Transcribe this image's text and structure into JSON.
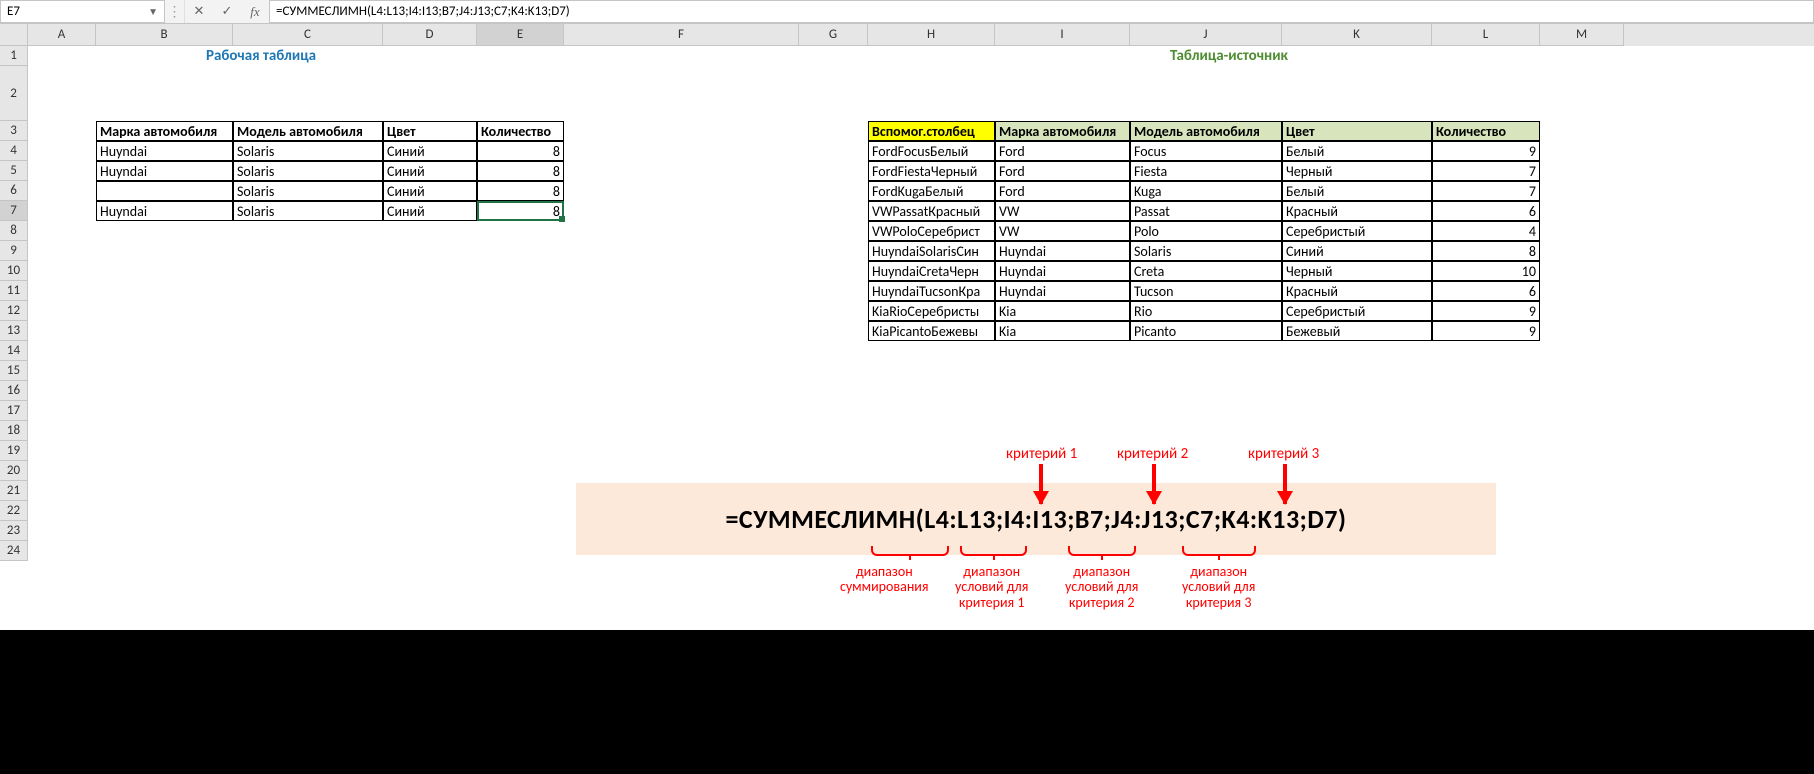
{
  "nameBox": "E7",
  "formula": "=СУММЕСЛИМН(L4:L13;I4:I13;B7;J4:J13;C7;K4:K13;D7)",
  "cols": [
    "",
    "A",
    "B",
    "C",
    "D",
    "E",
    "F",
    "G",
    "H",
    "I",
    "J",
    "K",
    "L",
    "M"
  ],
  "selectedCol": "E",
  "selectedRow": 7,
  "title1": "Рабочая таблица",
  "title2": "Таблица-источник",
  "wt": {
    "headers": [
      "Марка автомобиля",
      "Модель автомобиля",
      "Цвет",
      "Количество"
    ],
    "rows": [
      [
        "Huyndai",
        "Solaris",
        "Синий",
        "8"
      ],
      [
        "Huyndai",
        "Solaris",
        "Синий",
        "8"
      ],
      [
        "",
        "Solaris",
        "Синий",
        "8"
      ],
      [
        "Huyndai",
        "Solaris",
        "Синий",
        "8"
      ]
    ]
  },
  "st": {
    "headers": [
      "Вспомог.столбец",
      "Марка автомобиля",
      "Модель автомобиля",
      "Цвет",
      "Количество"
    ],
    "rows": [
      [
        "FordFocusБелый",
        "Ford",
        "Focus",
        "Белый",
        "9"
      ],
      [
        "FordFiestaЧерный",
        "Ford",
        "Fiesta",
        "Черный",
        "7"
      ],
      [
        "FordKugaБелый",
        "Ford",
        "Kuga",
        "Белый",
        "7"
      ],
      [
        "VWPassatКрасный",
        "VW",
        "Passat",
        "Красный",
        "6"
      ],
      [
        "VWPoloСеребрист",
        "VW",
        "Polo",
        "Серебристый",
        "4"
      ],
      [
        "HuyndaiSolarisСин",
        "Huyndai",
        "Solaris",
        "Синий",
        "8"
      ],
      [
        "HuyndaiCretaЧерн",
        "Huyndai",
        "Creta",
        "Черный",
        "10"
      ],
      [
        "HuyndaiTucsonКра",
        "Huyndai",
        "Tucson",
        "Красный",
        "6"
      ],
      [
        "KiaRioСеребристы",
        "Kia",
        "Rio",
        "Серебристый",
        "9"
      ],
      [
        "KiaPicantoБежевы",
        "Kia",
        "Picanto",
        "Бежевый",
        "9"
      ]
    ]
  },
  "annot": {
    "formula": "=СУММЕСЛИМН(L4:L13;I4:I13;B7;J4:J13;C7;K4:K13;D7)",
    "top": [
      "критерий 1",
      "критерий 2",
      "критерий 3"
    ],
    "bot": [
      "диапазон\nсуммирования",
      "диапазон\nусловий для\nкритерия 1",
      "диапазон\nусловий для\nкритерия 2",
      "диапазон\nусловий для\nкритерия 3"
    ]
  }
}
